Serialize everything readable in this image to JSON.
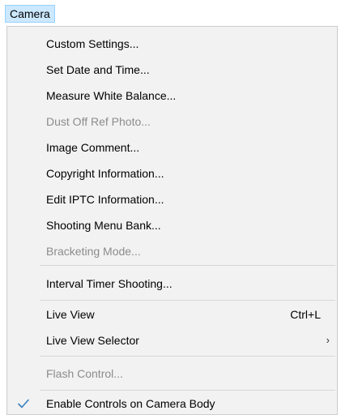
{
  "menubar": {
    "camera_label": "Camera"
  },
  "menu": {
    "items": [
      {
        "label": "Custom Settings...",
        "enabled": true
      },
      {
        "label": "Set Date and Time...",
        "enabled": true
      },
      {
        "label": "Measure White Balance...",
        "enabled": true
      },
      {
        "label": "Dust Off Ref Photo...",
        "enabled": false
      },
      {
        "label": "Image Comment...",
        "enabled": true
      },
      {
        "label": "Copyright Information...",
        "enabled": true
      },
      {
        "label": "Edit IPTC Information...",
        "enabled": true
      },
      {
        "label": "Shooting Menu Bank...",
        "enabled": true
      },
      {
        "label": "Bracketing Mode...",
        "enabled": false
      },
      {
        "label": "Interval Timer Shooting...",
        "enabled": true
      },
      {
        "label": "Live View",
        "shortcut": "Ctrl+L",
        "enabled": true
      },
      {
        "label": "Live View Selector",
        "submenu_arrow": "›",
        "enabled": true
      },
      {
        "label": "Flash Control...",
        "enabled": false
      },
      {
        "label": "Enable Controls on Camera Body",
        "checked": true,
        "enabled": true
      }
    ]
  },
  "colors": {
    "menubar_highlight": "#cce8ff",
    "menu_background": "#f2f2f2",
    "disabled_text": "#8c8c8c",
    "check_color": "#3a7fc1"
  },
  "icons": {
    "checkmark": "check-icon",
    "submenu": "chevron-right-icon"
  }
}
